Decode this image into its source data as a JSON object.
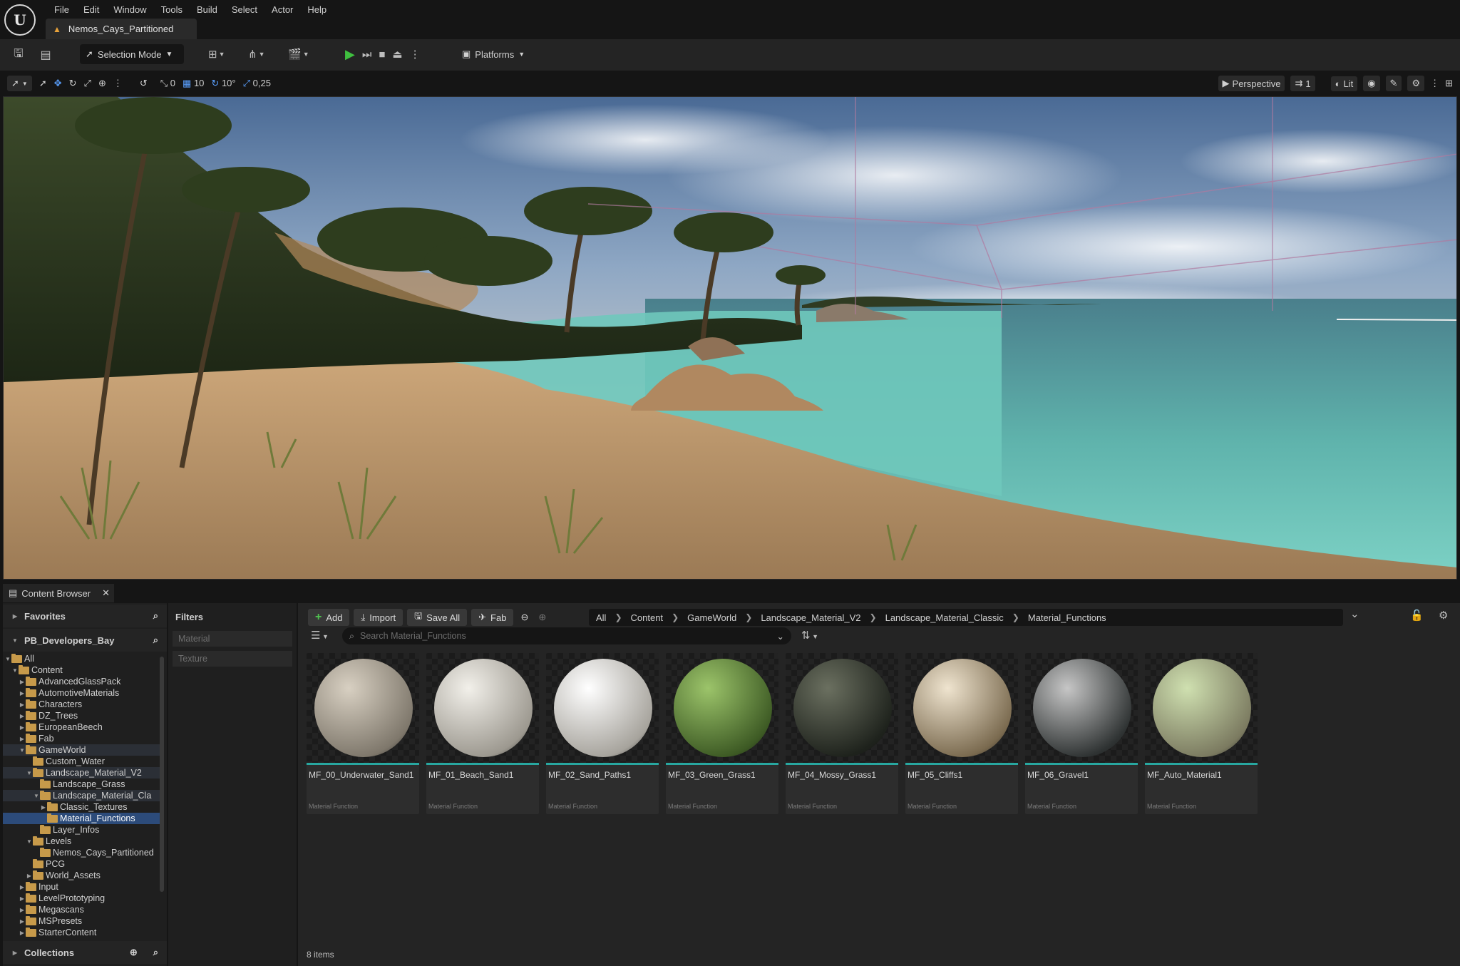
{
  "app": {
    "logo_text": "U",
    "document_tab": "Nemos_Cays_Partitioned"
  },
  "menu": [
    "File",
    "Edit",
    "Window",
    "Tools",
    "Build",
    "Select",
    "Actor",
    "Help"
  ],
  "toolbar": {
    "selection_mode": "Selection Mode",
    "platforms": "Platforms"
  },
  "viewport_toolbar": {
    "rotate_snap": "0",
    "grid_snap": "10",
    "angle_snap": "10°",
    "scale_snap": "0,25",
    "perspective": "Perspective",
    "camera_speed": "1",
    "view_mode": "Lit"
  },
  "content_browser": {
    "tab_label": "Content Browser",
    "favorites_label": "Favorites",
    "project_label": "PB_Developers_Bay",
    "collections_label": "Collections",
    "filters_label": "Filters",
    "filter_items": [
      "Material",
      "Texture"
    ],
    "add_label": "Add",
    "import_label": "Import",
    "save_all_label": "Save All",
    "fab_label": "Fab",
    "breadcrumb": [
      "All",
      "Content",
      "GameWorld",
      "Landscape_Material_V2",
      "Landscape_Material_Classic",
      "Material_Functions"
    ],
    "search_placeholder": "Search Material_Functions",
    "item_count": "8 items",
    "tree": [
      {
        "label": "All",
        "depth": 0,
        "expanded": true
      },
      {
        "label": "Content",
        "depth": 1,
        "expanded": true
      },
      {
        "label": "AdvancedGlassPack",
        "depth": 2
      },
      {
        "label": "AutomotiveMaterials",
        "depth": 2
      },
      {
        "label": "Characters",
        "depth": 2
      },
      {
        "label": "DZ_Trees",
        "depth": 2
      },
      {
        "label": "EuropeanBeech",
        "depth": 2
      },
      {
        "label": "Fab",
        "depth": 2
      },
      {
        "label": "GameWorld",
        "depth": 2,
        "expanded": true,
        "highlight": true
      },
      {
        "label": "Custom_Water",
        "depth": 3,
        "leaf": true
      },
      {
        "label": "Landscape_Material_V2",
        "depth": 3,
        "expanded": true,
        "highlight": true
      },
      {
        "label": "Landscape_Grass",
        "depth": 4,
        "leaf": true
      },
      {
        "label": "Landscape_Material_Cla",
        "depth": 4,
        "expanded": true,
        "highlight": true
      },
      {
        "label": "Classic_Textures",
        "depth": 5
      },
      {
        "label": "Material_Functions",
        "depth": 5,
        "leaf": true,
        "selected": true
      },
      {
        "label": "Layer_Infos",
        "depth": 4,
        "leaf": true
      },
      {
        "label": "Levels",
        "depth": 3,
        "expanded": true
      },
      {
        "label": "Nemos_Cays_Partitioned",
        "depth": 4,
        "leaf": true
      },
      {
        "label": "PCG",
        "depth": 3,
        "leaf": true
      },
      {
        "label": "World_Assets",
        "depth": 3
      },
      {
        "label": "Input",
        "depth": 2
      },
      {
        "label": "LevelPrototyping",
        "depth": 2
      },
      {
        "label": "Megascans",
        "depth": 2
      },
      {
        "label": "MSPresets",
        "depth": 2
      },
      {
        "label": "StarterContent",
        "depth": 2
      }
    ],
    "assets": [
      {
        "name": "MF_00_Underwater_Sand1",
        "type": "Material Function",
        "color_hi": "#d8d0c2",
        "color_lo": "#7e776b"
      },
      {
        "name": "MF_01_Beach_Sand1",
        "type": "Material Function",
        "color_hi": "#f2f0ea",
        "color_lo": "#9c988f"
      },
      {
        "name": "MF_02_Sand_Paths1",
        "type": "Material Function",
        "color_hi": "#ffffff",
        "color_lo": "#a6a39c"
      },
      {
        "name": "MF_03_Green_Grass1",
        "type": "Material Function",
        "color_hi": "#9cc46a",
        "color_lo": "#3d5a24"
      },
      {
        "name": "MF_04_Mossy_Grass1",
        "type": "Material Function",
        "color_hi": "#6b7060",
        "color_lo": "#1e221c"
      },
      {
        "name": "MF_05_Cliffs1",
        "type": "Material Function",
        "color_hi": "#efe4cf",
        "color_lo": "#7a6a4f"
      },
      {
        "name": "MF_06_Gravel1",
        "type": "Material Function",
        "color_hi": "#c6c6c6",
        "color_lo": "#2f3333"
      },
      {
        "name": "MF_Auto_Material1",
        "type": "Material Function",
        "color_hi": "#cfe0b0",
        "color_lo": "#7b7a60"
      }
    ]
  }
}
